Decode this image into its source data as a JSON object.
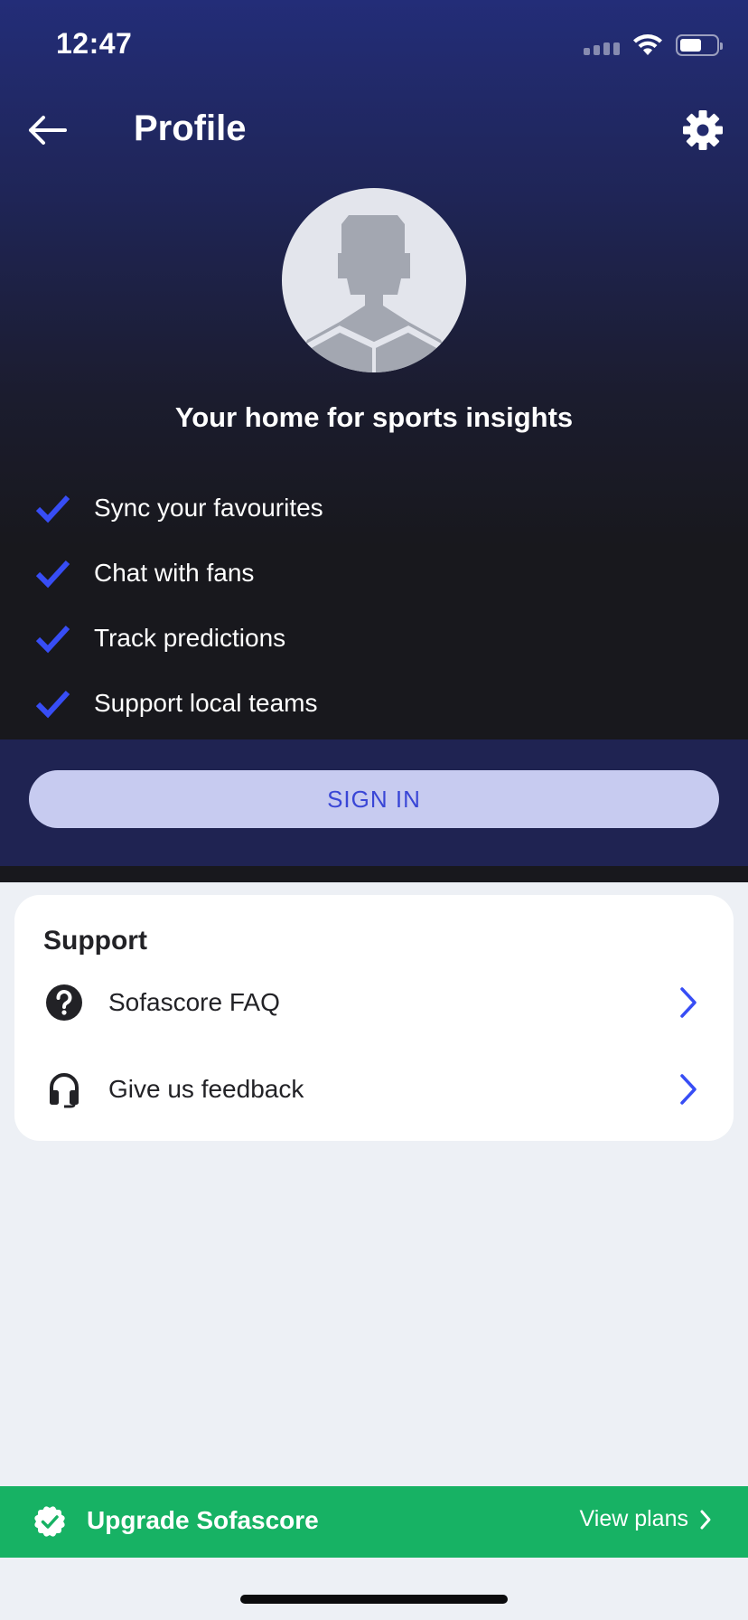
{
  "status_bar": {
    "time": "12:47",
    "battery_level": 0.6
  },
  "header": {
    "title": "Profile"
  },
  "hero": {
    "tagline": "Your home for sports insights",
    "features": [
      "Sync your favourites",
      "Chat with fans",
      "Track predictions",
      "Support local teams"
    ],
    "sign_in_label": "SIGN IN"
  },
  "support": {
    "title": "Support",
    "items": [
      {
        "label": "Sofascore FAQ",
        "icon": "help-circle-icon"
      },
      {
        "label": "Give us feedback",
        "icon": "headset-icon"
      }
    ]
  },
  "upgrade": {
    "label": "Upgrade Sofascore",
    "link_label": "View plans",
    "icon": "verified-badge-icon"
  },
  "colors": {
    "accent": "#374df5",
    "upgrade_green": "#17b264",
    "signin_bg": "#c7cbf0",
    "header_blue": "#232d78"
  }
}
